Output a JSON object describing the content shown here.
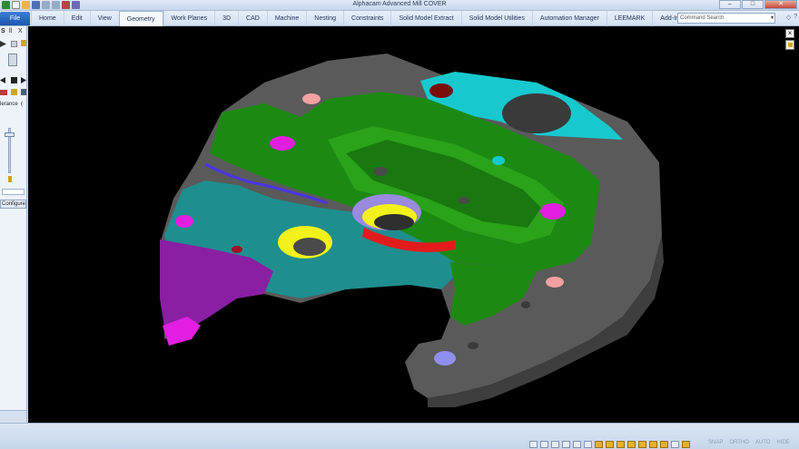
{
  "window": {
    "title": "Alphacam Advanced Mill COVER",
    "controls": {
      "minimize": "–",
      "maximize": "□",
      "close": "✕"
    }
  },
  "ribbon": {
    "file_label": "File",
    "tabs": [
      "Home",
      "Edit",
      "View",
      "Geometry",
      "Work Planes",
      "3D",
      "CAD",
      "Machine",
      "Nesting",
      "Constraints",
      "Solid Model Extract",
      "Solid Model Utilities",
      "Automation Manager",
      "LEEMARK",
      "Add-Ins/Macros"
    ],
    "active_tab": "Geometry",
    "command_search_value": "Command Search"
  },
  "left_panel": {
    "top_labels": [
      "S",
      "ll",
      "X"
    ],
    "tolerance_label": "lerance",
    "tolerance_extra": "(",
    "configure_label": "Configure"
  },
  "viewport": {
    "close_label": "×"
  },
  "status_bar": {
    "modes": [
      "SNAP",
      "ORTHO",
      "AUTO",
      "HIDE"
    ]
  },
  "colors": {
    "background": "#000000",
    "part_body": "#5e5e5e",
    "green_face": "#1c8a12",
    "cyan_face": "#17c9cf",
    "teal_face": "#1f8e8e",
    "purple_face": "#8a1fa3",
    "magenta_hole": "#e21fe0",
    "yellow_face": "#f2f21a",
    "red_band": "#e21c1c",
    "blue_edge": "#4a35e6",
    "pink_hole": "#f2a0a0",
    "ribbon_active": "#1a56b0"
  }
}
